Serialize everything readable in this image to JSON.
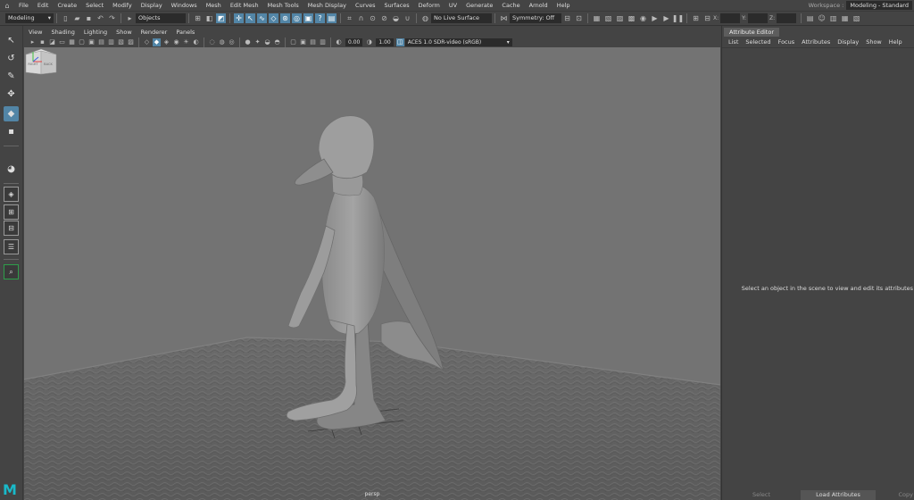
{
  "menubar": {
    "items": [
      "File",
      "Edit",
      "Create",
      "Select",
      "Modify",
      "Display",
      "Windows",
      "Mesh",
      "Edit Mesh",
      "Mesh Tools",
      "Mesh Display",
      "Curves",
      "Surfaces",
      "Deform",
      "UV",
      "Generate",
      "Cache",
      "Arnold",
      "Help"
    ],
    "workspace_label": "Workspace :",
    "workspace_value": "Modeling - Standard"
  },
  "statusline": {
    "menuset": "Modeling",
    "select_mode": "Objects",
    "live_surface": "No Live Surface",
    "symmetry": "Symmetry: Off",
    "x_label": "X:",
    "y_label": "Y:",
    "z_label": "Z:"
  },
  "viewport": {
    "menu": [
      "View",
      "Shading",
      "Lighting",
      "Show",
      "Renderer",
      "Panels"
    ],
    "exposure": "0.00",
    "gamma": "1.00",
    "color_space": "ACES 1.0 SDR-video (sRGB)",
    "camera": "persp",
    "cube_left": "RIGHT",
    "cube_right": "BACK"
  },
  "attribute_editor": {
    "tab": "Attribute Editor",
    "menu": [
      "List",
      "Selected",
      "Focus",
      "Attributes",
      "Display",
      "Show",
      "Help"
    ],
    "hint": "Select an object in the scene to view and edit its attributes",
    "select_label": "Select",
    "load_label": "Load Attributes",
    "copy_label": "Copy"
  },
  "colors": {
    "accent": "#5285a6",
    "viewport_bg": "#737373",
    "panel_bg": "#444444",
    "maya_logo": "#19b9c9"
  }
}
